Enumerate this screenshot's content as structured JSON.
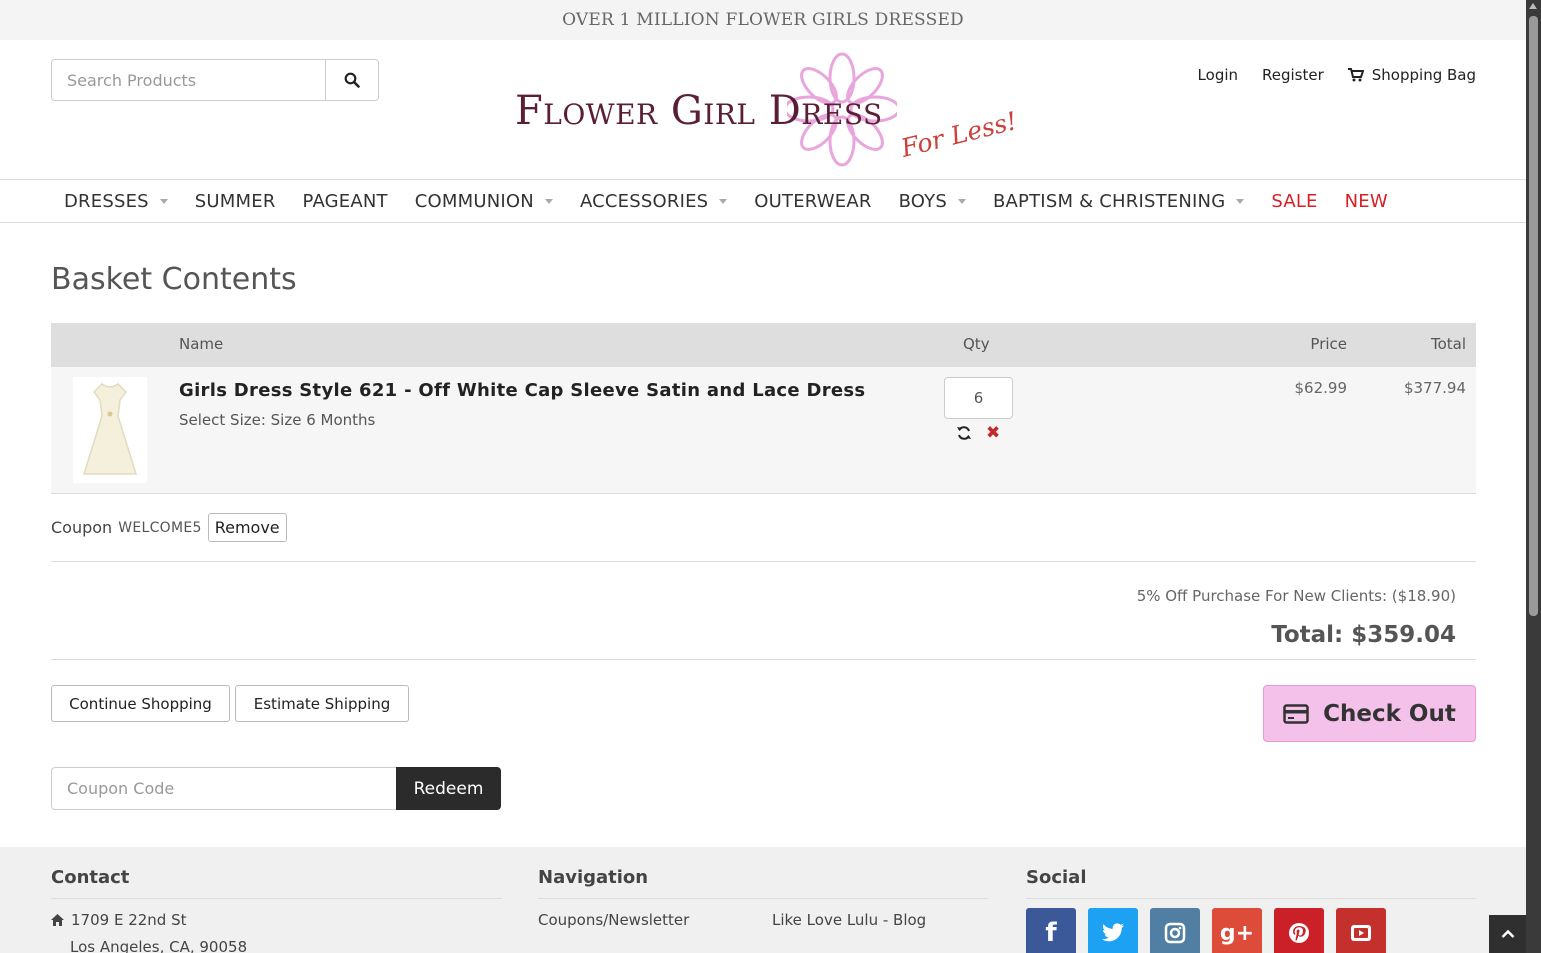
{
  "announcement": "OVER 1 MILLION FLOWER GIRLS DRESSED",
  "search": {
    "placeholder": "Search Products",
    "icon": "search-icon"
  },
  "logo": {
    "main": "Flower Girl Dress",
    "sub": "For Less!"
  },
  "header_links": {
    "login": "Login",
    "register": "Register",
    "cart": "Shopping Bag"
  },
  "nav": [
    {
      "label": "DRESSES",
      "dropdown": true
    },
    {
      "label": "SUMMER",
      "dropdown": false
    },
    {
      "label": "PAGEANT",
      "dropdown": false
    },
    {
      "label": "COMMUNION",
      "dropdown": true
    },
    {
      "label": "ACCESSORIES",
      "dropdown": true
    },
    {
      "label": "OUTERWEAR",
      "dropdown": false
    },
    {
      "label": "BOYS",
      "dropdown": true
    },
    {
      "label": "BAPTISM & CHRISTENING",
      "dropdown": true
    },
    {
      "label": "SALE",
      "dropdown": false,
      "color": "#d61f26"
    },
    {
      "label": "NEW",
      "dropdown": false,
      "color": "#d61f26"
    }
  ],
  "basket": {
    "title": "Basket Contents",
    "columns": {
      "name": "Name",
      "qty": "Qty",
      "price": "Price",
      "total": "Total"
    },
    "items": [
      {
        "name": "Girls Dress Style 621 - Off White Cap Sleeve Satin and Lace Dress",
        "option": "Select Size: Size 6 Months",
        "qty": "6",
        "price": "$62.99",
        "total": "$377.94"
      }
    ],
    "coupon_label": "Coupon",
    "coupon_code": "WELCOME5",
    "coupon_remove": "Remove",
    "discount": "5% Off Purchase For New Clients: ($18.90)",
    "grand_total": "Total: $359.04",
    "continue_label": "Continue Shopping",
    "estimate_label": "Estimate Shipping",
    "checkout_label": "Check Out",
    "coupon_placeholder": "Coupon Code",
    "redeem_label": "Redeem"
  },
  "footer": {
    "contact": {
      "heading": "Contact",
      "address1": "1709 E 22nd St",
      "address2": "Los Angeles, CA, 90058"
    },
    "navigation": {
      "heading": "Navigation",
      "links": [
        "Coupons/Newsletter",
        "Like Love Lulu - Blog"
      ]
    },
    "social": {
      "heading": "Social",
      "icons": [
        "facebook-icon",
        "twitter-icon",
        "instagram-icon",
        "google-plus-icon",
        "pinterest-icon",
        "youtube-icon"
      ]
    }
  },
  "colors": {
    "accent_pink": "#f4c1ea",
    "sale_red": "#d61f26",
    "redeem_dark": "#2b2b2b"
  }
}
